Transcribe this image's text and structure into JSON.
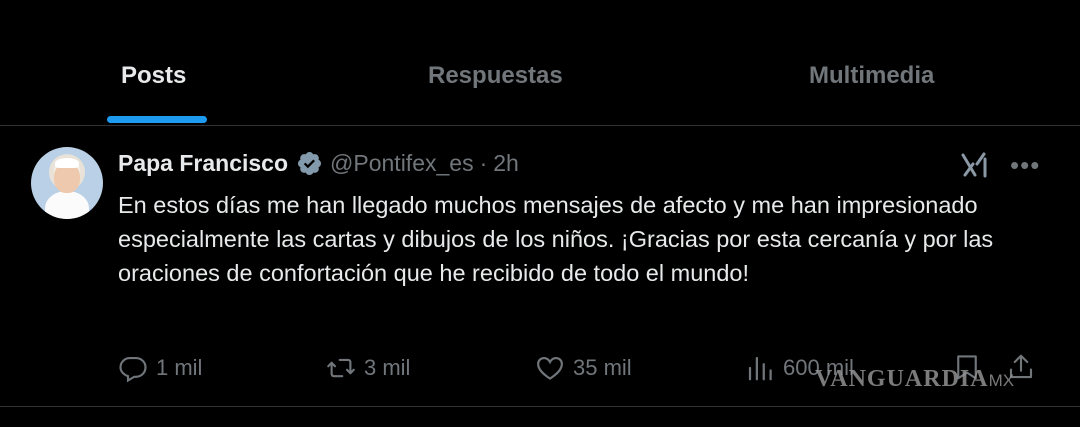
{
  "tabs": [
    {
      "label": "Posts",
      "active": true
    },
    {
      "label": "Respuestas",
      "active": false
    },
    {
      "label": "Multimedia",
      "active": false
    }
  ],
  "colors": {
    "accent": "#1d9bf0",
    "background": "#000000",
    "text": "#e7e9ea",
    "muted": "#71767b"
  },
  "post": {
    "author_name": "Papa Francisco",
    "handle": "@Pontifex_es",
    "separator": "·",
    "time": "2h",
    "text": "En estos días me han llegado muchos mensajes de afecto y me han impresionado especialmente las cartas y dibujos de los niños. ¡Gracias por esta cercanía y por las oraciones de confortación que he recibido de todo el mundo!",
    "actions": {
      "replies": "1 mil",
      "reposts": "3 mil",
      "likes": "35 mil",
      "views": "600 mil"
    }
  },
  "icons": {
    "verified": "verified-badge-icon",
    "grok": "grok-icon",
    "more": "more-icon",
    "reply": "reply-icon",
    "repost": "repost-icon",
    "like": "heart-icon",
    "views": "views-icon",
    "bookmark": "bookmark-icon",
    "share": "share-icon"
  },
  "watermark": {
    "brand": "VANGUARDIA",
    "suffix": "MX"
  }
}
